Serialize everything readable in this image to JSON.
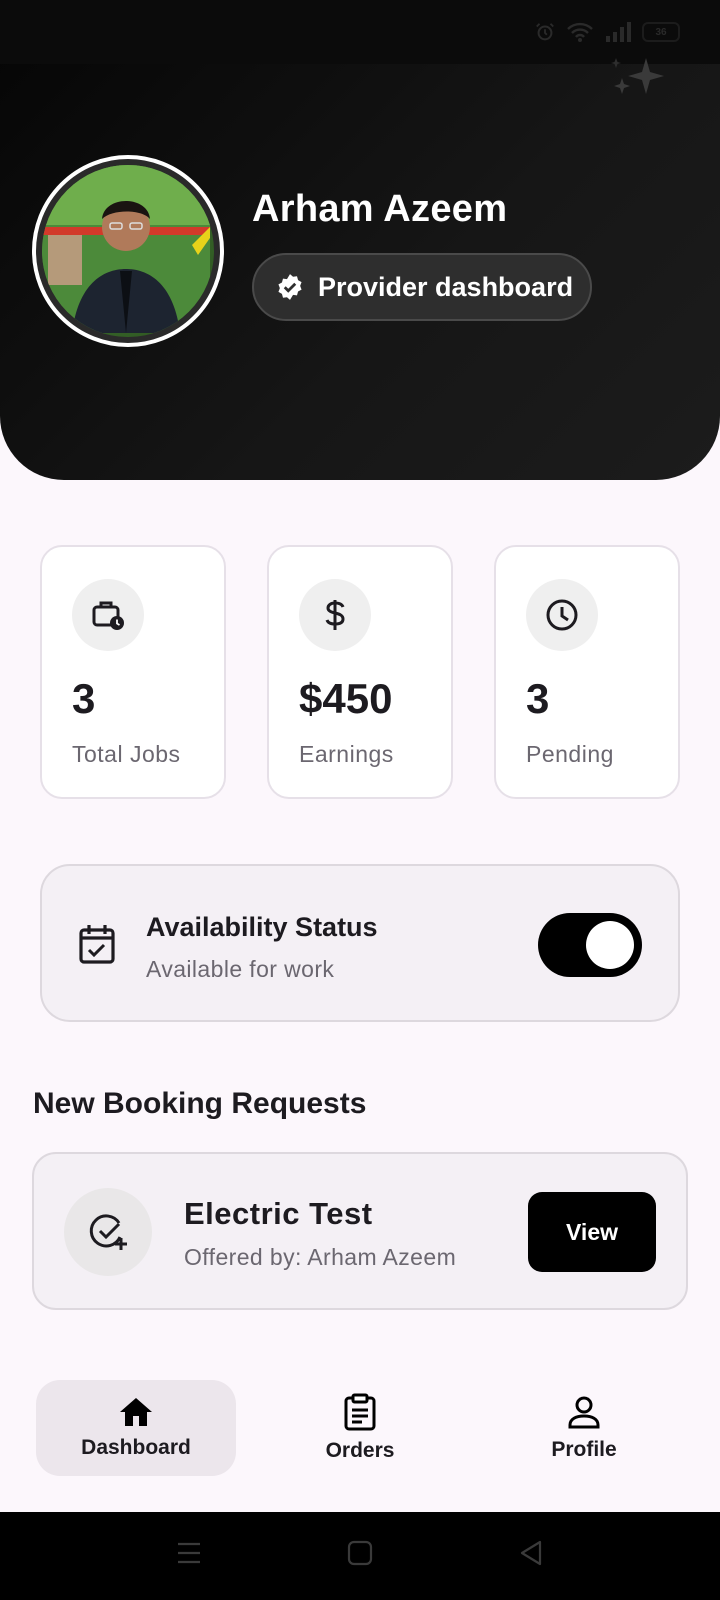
{
  "header": {
    "user_name": "Arham Azeem",
    "role_chip": "Provider dashboard",
    "battery": "36"
  },
  "stats": [
    {
      "value": "3",
      "label": "Total Jobs",
      "icon": "briefcase-clock-icon"
    },
    {
      "value": "$450",
      "label": "Earnings",
      "icon": "dollar-icon"
    },
    {
      "value": "3",
      "label": "Pending",
      "icon": "clock-icon"
    }
  ],
  "availability": {
    "title": "Availability Status",
    "subtitle": "Available for work",
    "toggle_on": true
  },
  "booking_section": {
    "title": "New Booking Requests",
    "items": [
      {
        "title": "Electric Test",
        "subtitle": "Offered by: Arham Azeem",
        "action": "View"
      }
    ]
  },
  "nav": {
    "items": [
      {
        "label": "Dashboard",
        "icon": "home-icon",
        "active": true
      },
      {
        "label": "Orders",
        "icon": "clipboard-icon",
        "active": false
      },
      {
        "label": "Profile",
        "icon": "person-icon",
        "active": false
      }
    ]
  },
  "colors": {
    "accent": "#000000",
    "background": "#fcf7fc",
    "header": "#111111"
  }
}
